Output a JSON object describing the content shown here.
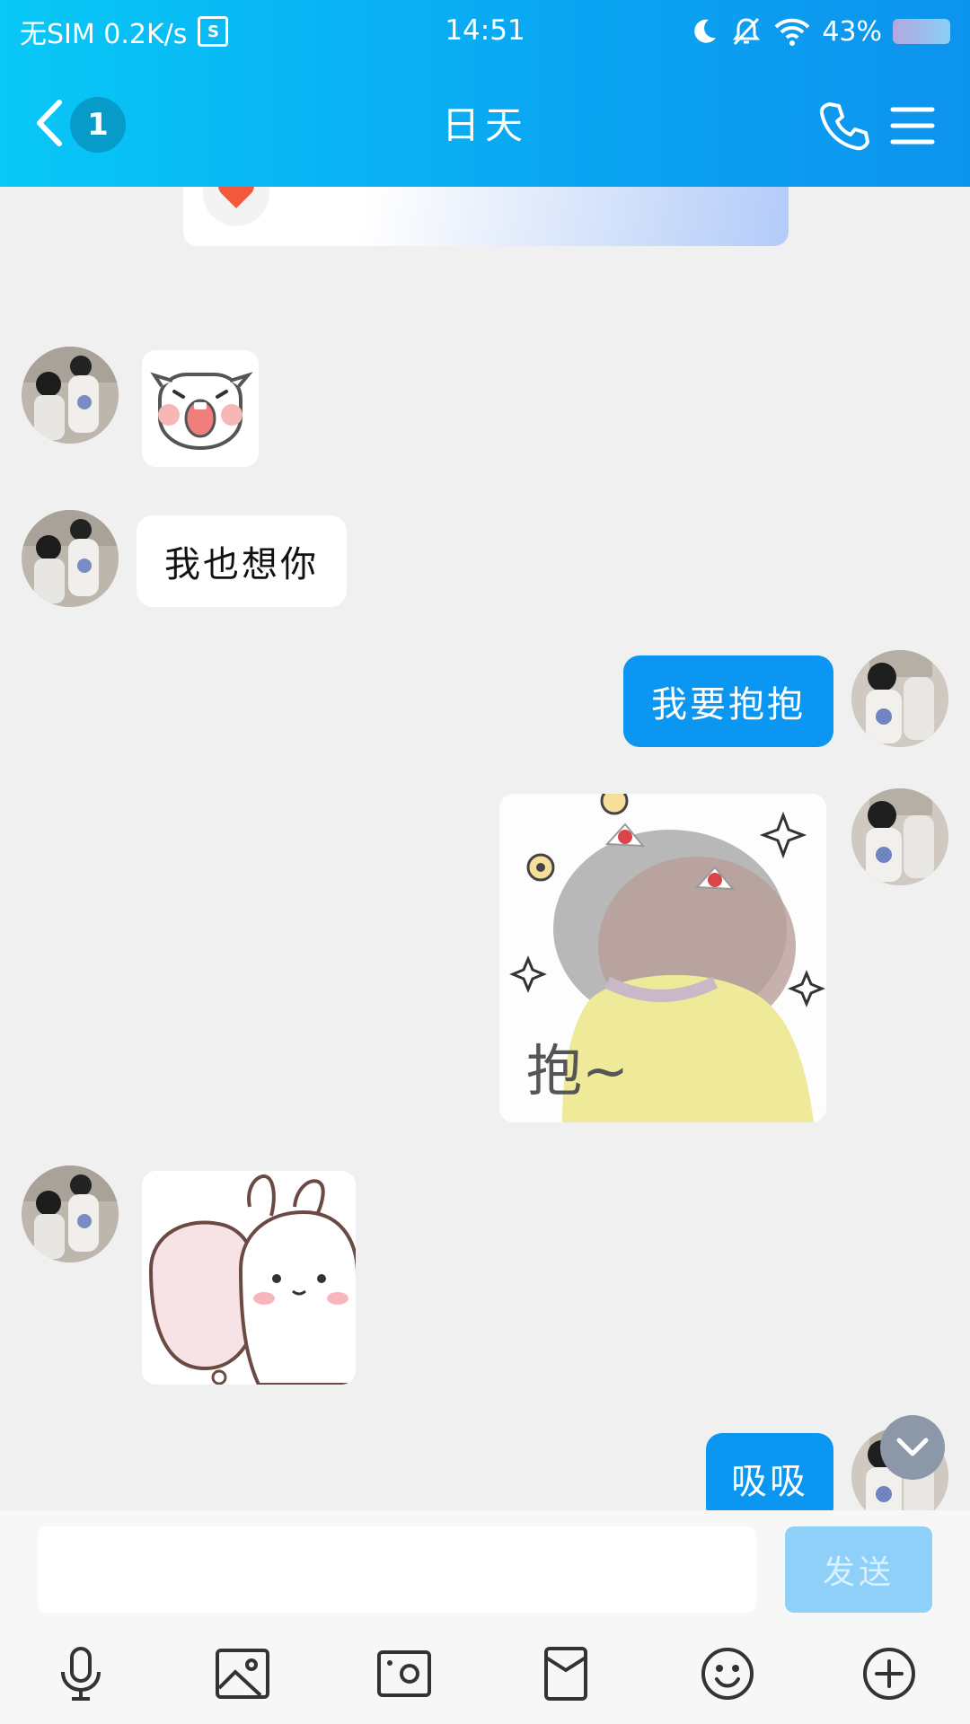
{
  "status_bar": {
    "network": "无SIM 0.2K/s",
    "sim_icon_letter": "S",
    "time": "14:51",
    "battery": "43%"
  },
  "header": {
    "unread_badge": "1",
    "title": "日天"
  },
  "messages": [
    {
      "direction": "incoming",
      "type": "sticker",
      "sticker": "pig-laughing-sticker"
    },
    {
      "direction": "incoming",
      "type": "text",
      "text": "我也想你"
    },
    {
      "direction": "outgoing",
      "type": "text",
      "text": "我要抱抱"
    },
    {
      "direction": "outgoing",
      "type": "sticker",
      "sticker": "girl-hug-sticker",
      "caption": "抱~"
    },
    {
      "direction": "incoming",
      "type": "sticker",
      "sticker": "bunny-hug-sticker"
    },
    {
      "direction": "outgoing",
      "type": "text",
      "text": "吸吸"
    }
  ],
  "input": {
    "value": "",
    "placeholder": "",
    "send_label": "发送"
  },
  "toolbar": [
    "microphone-icon",
    "image-icon",
    "camera-icon",
    "red-packet-icon",
    "emoji-icon",
    "plus-icon"
  ],
  "colors": {
    "header_start": "#08c8f6",
    "header_end": "#0c93ee",
    "outgoing_bubble": "#0b97f1",
    "background": "#f0f0f0",
    "send_disabled": "#8fd0f8"
  }
}
